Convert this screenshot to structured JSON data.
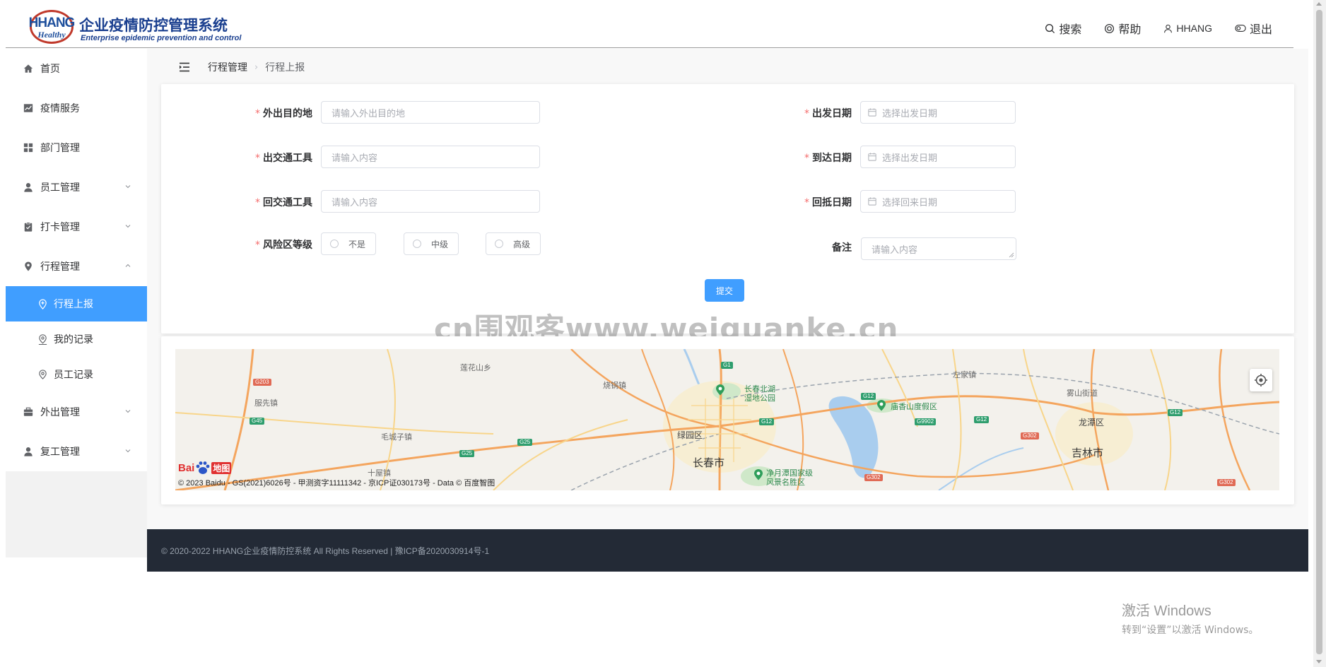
{
  "header": {
    "logo": {
      "mark_text": "HHANG",
      "mark_sub": "Healthy",
      "title": "企业疫情防控管理系统",
      "subtitle": "Enterprise epidemic prevention and control"
    },
    "actions": {
      "search": "搜索",
      "help": "帮助",
      "user": "HHANG",
      "logout": "退出"
    }
  },
  "sidebar": {
    "items": [
      {
        "label": "首页",
        "icon": "home-icon"
      },
      {
        "label": "疫情服务",
        "icon": "chart-icon"
      },
      {
        "label": "部门管理",
        "icon": "grid-icon"
      },
      {
        "label": "员工管理",
        "icon": "user-icon",
        "expandable": true
      },
      {
        "label": "打卡管理",
        "icon": "clipboard-icon",
        "expandable": true
      },
      {
        "label": "行程管理",
        "icon": "location-icon",
        "expanded": true
      },
      {
        "label": "外出管理",
        "icon": "briefcase-icon",
        "expandable": true
      },
      {
        "label": "复工管理",
        "icon": "user-icon",
        "expandable": true
      }
    ],
    "sub_items": [
      {
        "label": "行程上报",
        "active": true
      },
      {
        "label": "我的记录"
      },
      {
        "label": "员工记录"
      }
    ]
  },
  "breadcrumb": [
    "行程管理",
    "行程上报"
  ],
  "form": {
    "destination": {
      "label": "外出目的地",
      "placeholder": "请输入外出目的地"
    },
    "out_transport": {
      "label": "出交通工具",
      "placeholder": "请输入内容"
    },
    "return_transport": {
      "label": "回交通工具",
      "placeholder": "请输入内容"
    },
    "risk_level": {
      "label": "风险区等级",
      "options": [
        "不是",
        "中级",
        "高级"
      ]
    },
    "depart_date": {
      "label": "出发日期",
      "placeholder": "选择出发日期"
    },
    "arrive_date": {
      "label": "到达日期",
      "placeholder": "选择出发日期"
    },
    "return_date": {
      "label": "回抵日期",
      "placeholder": "选择回来日期"
    },
    "remark": {
      "label": "备注",
      "placeholder": "请输入内容"
    },
    "submit": "提交"
  },
  "watermark": "cn围观客www.weiguanke.cn",
  "map": {
    "labels": {
      "lianhua": "莲花山乡",
      "shaoguo": "烧锅镇",
      "fuxian": "服先镇",
      "maocheng": "毛城子镇",
      "shiwu": "十屋镇",
      "beihu": "长春北湖",
      "beihu2": "湿地公园",
      "lvyuan": "绿园区",
      "changchun": "长春市",
      "jingyue": "净月潭国家级",
      "jingyue2": "风景名胜区",
      "miaoxiang": "庙香山度假区",
      "zuojia": "左家镇",
      "yanshan": "雾山街道",
      "longtan": "龙潭区",
      "jilin": "吉林市"
    },
    "shields": [
      "G203",
      "G45",
      "G25",
      "G25",
      "G1",
      "G12",
      "G12",
      "G9902",
      "G12",
      "G12",
      "G302",
      "G302",
      "G302"
    ],
    "logo_text": "Bai",
    "logo_ditu": "地图",
    "copyright": "© 2023 Baidu - GS(2021)6026号 - 甲测资字11111342 - 京ICP证030173号 - Data © 百度智图"
  },
  "footer": {
    "text": "© 2020-2022 HHANG企业疫情防控系统 All Rights Reserved | 豫ICP备2020030914号-1"
  },
  "windows_activation": {
    "title": "激活 Windows",
    "subtitle": "转到“设置”以激活 Windows。"
  },
  "colors": {
    "primary": "#409eff",
    "required": "#f56c6c",
    "footer_bg": "#232a36",
    "brand": "#1a3f8f"
  }
}
